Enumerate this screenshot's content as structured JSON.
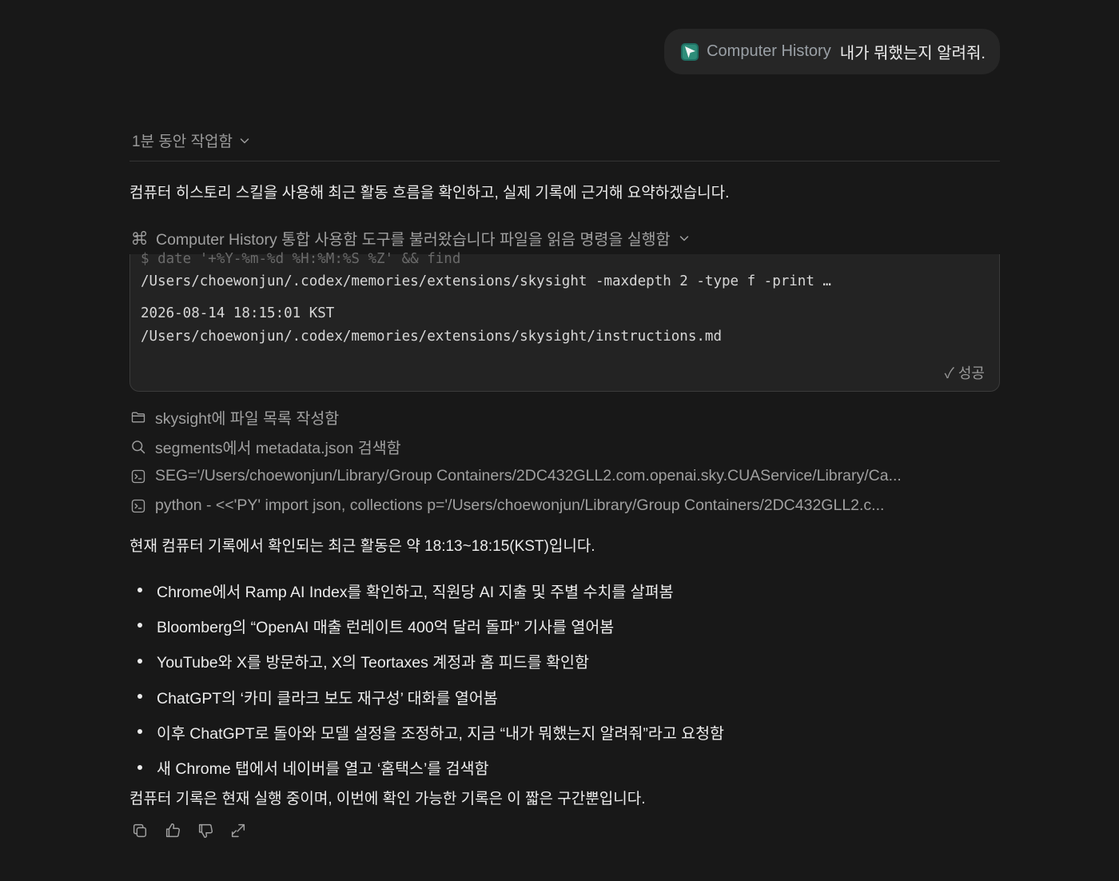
{
  "user_message": {
    "skill_chip": "Computer History",
    "text": "내가 뭐했는지 알려줘."
  },
  "worked": {
    "label": "1분 동안 작업함"
  },
  "intro": "컴퓨터 히스토리 스킬을 사용해 최근 활동 흐름을 확인하고, 실제 기록에 근거해 요약하겠습니다.",
  "tool_header": "Computer History 통합 사용함 도구를 불러왔습니다 파일을 읽음 명령을 실행함",
  "terminal": {
    "command_faded": "$ date '+%Y-%m-%d %H:%M:%S %Z' && find",
    "command_line2": "/Users/choewonjun/.codex/memories/extensions/skysight -maxdepth 2 -type f -print …",
    "output_line1": "2026-08-14 18:15:01 KST",
    "output_line2": "/Users/choewonjun/.codex/memories/extensions/skysight/instructions.md",
    "status": "✓ 성공"
  },
  "steps": [
    {
      "icon": "folder-icon",
      "text": "skysight에 파일 목록 작성함"
    },
    {
      "icon": "search-icon",
      "text": "segments에서 metadata.json 검색함"
    },
    {
      "icon": "terminal-icon",
      "text": "SEG='/Users/choewonjun/Library/Group Containers/2DC432GLL2.com.openai.sky.CUAService/Library/Ca..."
    },
    {
      "icon": "terminal-icon",
      "text": "python - <<'PY' import json, collections p='/Users/choewonjun/Library/Group Containers/2DC432GLL2.c..."
    }
  ],
  "summary_intro": "현재 컴퓨터 기록에서 확인되는 최근 활동은 약 18:13~18:15(KST)입니다.",
  "bullets": [
    "Chrome에서 Ramp AI Index를 확인하고, 직원당 AI 지출 및 주별 수치를 살펴봄",
    "Bloomberg의 “OpenAI 매출 런레이트 400억 달러 돌파” 기사를 열어봄",
    "YouTube와 X를 방문하고, X의 Teortaxes 계정과 홈 피드를 확인함",
    "ChatGPT의 ‘카미 클라크 보도 재구성’ 대화를 열어봄",
    "이후 ChatGPT로 돌아와 모델 설정을 조정하고, 지금 “내가 뭐했는지 알려줘”라고 요청함",
    "새 Chrome 탭에서 네이버를 열고 ‘홈택스’를 검색함"
  ],
  "closing": "컴퓨터 기록은 현재 실행 중이며, 이번에 확인 가능한 기록은 이 짧은 구간뿐입니다.",
  "actions": [
    "copy-icon",
    "thumbs-up-icon",
    "thumbs-down-icon",
    "share-icon"
  ]
}
